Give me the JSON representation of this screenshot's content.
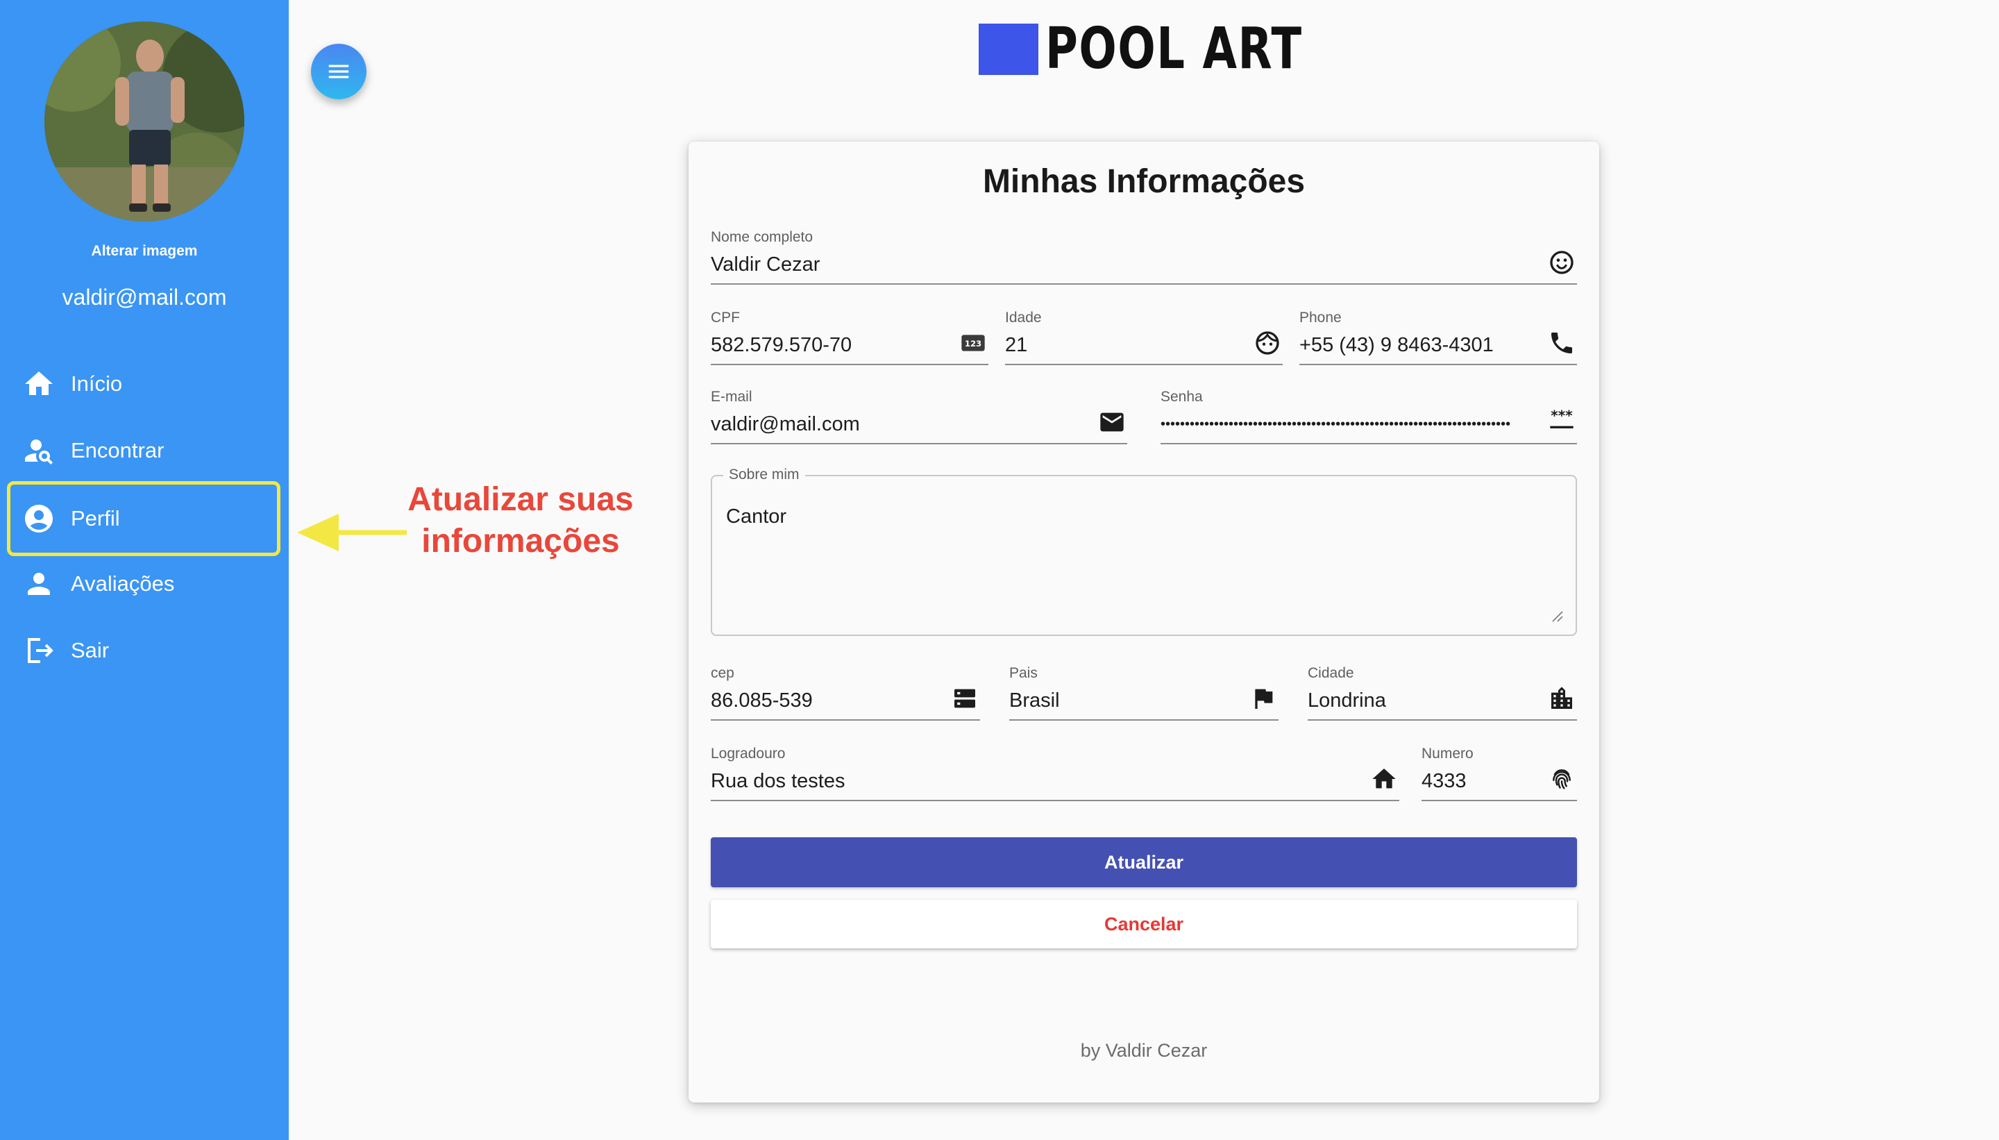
{
  "sidebar": {
    "change_image_label": "Alterar imagem",
    "user_email": "valdir@mail.com",
    "items": [
      {
        "label": "Início",
        "icon": "home-icon"
      },
      {
        "label": "Encontrar",
        "icon": "person-search-icon"
      },
      {
        "label": "Perfil",
        "icon": "account-circle-icon",
        "highlighted": true
      },
      {
        "label": "Avaliações",
        "icon": "person-icon"
      },
      {
        "label": "Sair",
        "icon": "logout-icon"
      }
    ]
  },
  "logo": {
    "text": "POOL ART"
  },
  "annotation": {
    "text_line1": "Atualizar suas",
    "text_line2": "informações"
  },
  "form": {
    "title": "Minhas Informações",
    "fields": {
      "full_name": {
        "label": "Nome completo",
        "value": "Valdir Cezar",
        "icon": "smiley-icon"
      },
      "cpf": {
        "label": "CPF",
        "value": "582.579.570-70",
        "icon": "number-123-icon"
      },
      "age": {
        "label": "Idade",
        "value": "21",
        "icon": "face-icon"
      },
      "phone": {
        "label": "Phone",
        "value": "+55 (43) 9 8463-4301",
        "icon": "phone-icon"
      },
      "email": {
        "label": "E-mail",
        "value": "valdir@mail.com",
        "icon": "mail-icon"
      },
      "password": {
        "label": "Senha",
        "value": "••••••••••••••••••••••••••••••••••••••••••••••••••••••••••••••••••••••••",
        "icon": "password-icon"
      },
      "about": {
        "label": "Sobre mim",
        "value": "Cantor"
      },
      "cep": {
        "label": "cep",
        "value": "86.085-539",
        "icon": "dns-icon"
      },
      "country": {
        "label": "Pais",
        "value": "Brasil",
        "icon": "flag-icon"
      },
      "city": {
        "label": "Cidade",
        "value": "Londrina",
        "icon": "city-icon"
      },
      "street": {
        "label": "Logradouro",
        "value": "Rua dos testes",
        "icon": "home-icon"
      },
      "number": {
        "label": "Numero",
        "value": "4333",
        "icon": "fingerprint-icon"
      }
    },
    "update_label": "Atualizar",
    "cancel_label": "Cancelar",
    "footer": "by Valdir Cezar"
  },
  "colors": {
    "sidebar_bg": "#3a95f4",
    "primary_button": "#4451b2",
    "cancel_text": "#e53935",
    "annotation": "#e8473a",
    "highlight_border": "#f3e843",
    "logo_square": "#3d55e8"
  }
}
